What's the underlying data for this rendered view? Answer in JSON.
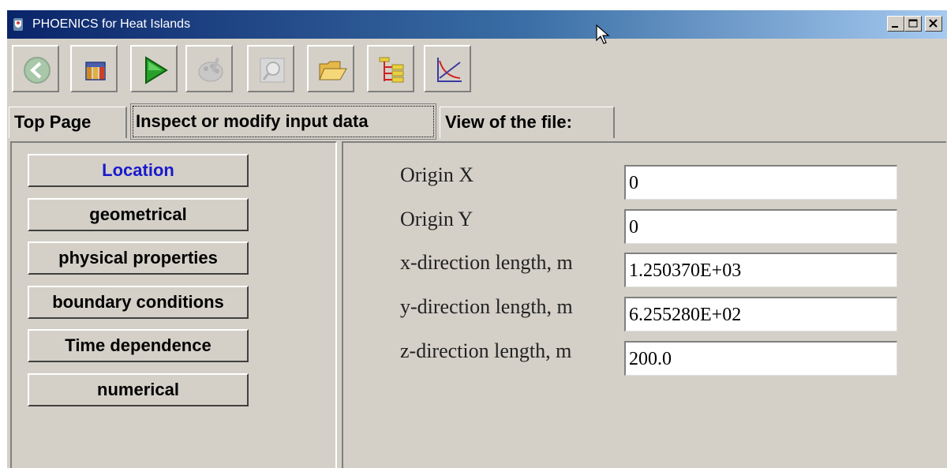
{
  "window": {
    "title": "PHOENICS for Heat Islands",
    "controls": {
      "minimize": "minimize",
      "maximize": "maximize",
      "close": "close"
    }
  },
  "toolbar": {
    "buttons": [
      {
        "icon": "back-arrow-icon",
        "enabled": false
      },
      {
        "icon": "model-icon",
        "enabled": true
      },
      {
        "icon": "run-play-icon",
        "enabled": true
      },
      {
        "icon": "palette-icon",
        "enabled": false
      },
      {
        "icon": "view-results-icon",
        "enabled": false
      },
      {
        "icon": "open-folder-icon",
        "enabled": true
      },
      {
        "icon": "tree-icon",
        "enabled": true
      },
      {
        "icon": "graph-icon",
        "enabled": true
      }
    ]
  },
  "tabs": [
    {
      "label": "Top Page"
    },
    {
      "label": "Inspect or modify input data",
      "active": true
    },
    {
      "label": "View of the file:"
    }
  ],
  "nav": [
    {
      "label": "Location",
      "active": true
    },
    {
      "label": "geometrical"
    },
    {
      "label": "physical properties"
    },
    {
      "label": "boundary conditions"
    },
    {
      "label": "Time dependence"
    },
    {
      "label": "numerical"
    }
  ],
  "fields": [
    {
      "label": "Origin X",
      "value": "0"
    },
    {
      "label": "Origin Y",
      "value": "0"
    },
    {
      "label": "x-direction length, m",
      "value": "1.250370E+03"
    },
    {
      "label": "y-direction length, m",
      "value": "6.255280E+02"
    },
    {
      "label": "z-direction length, m",
      "value": "200.0"
    }
  ],
  "colors": {
    "title_bar_start": "#0a246a",
    "title_bar_end": "#a6caf0",
    "window_bg": "#d4d0c8",
    "active_nav_text": "#1a1acc"
  }
}
